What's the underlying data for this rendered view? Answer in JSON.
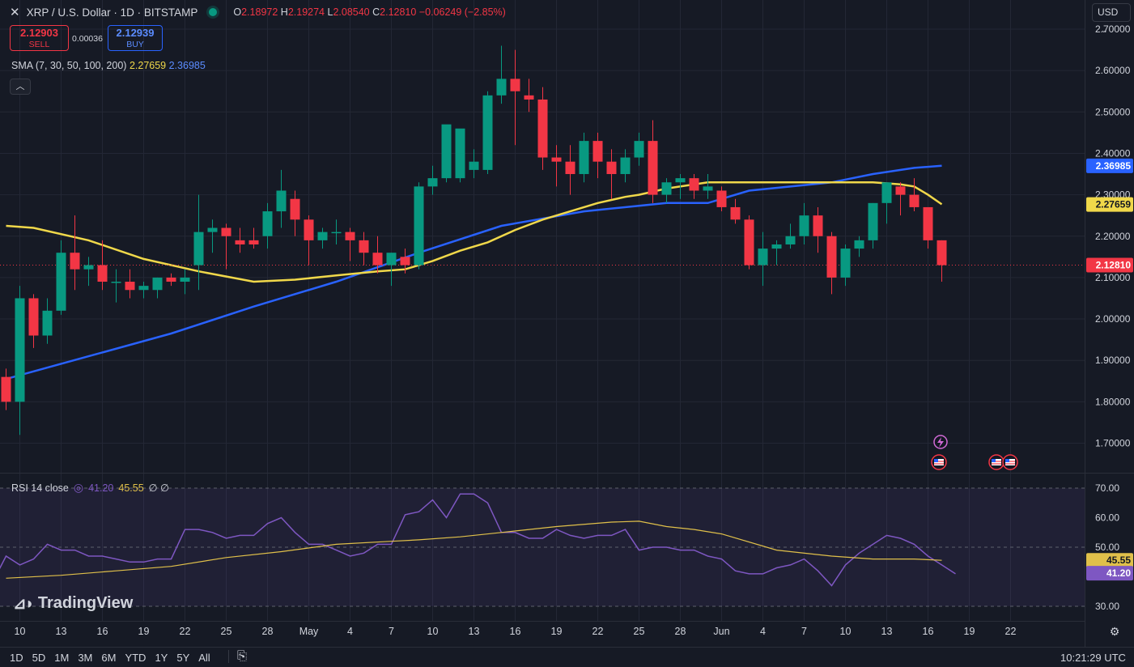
{
  "header": {
    "symbol": "XRP / U.S. Dollar · 1D · BITSTAMP",
    "ohlc": {
      "o_label": "O",
      "o": "2.18972",
      "h_label": "H",
      "h": "2.19274",
      "l_label": "L",
      "l": "2.08540",
      "c_label": "C",
      "c": "2.12810",
      "change": "−0.06249 (−2.85%)"
    }
  },
  "trade": {
    "sell_price": "2.12903",
    "sell_label": "SELL",
    "spread": "0.00036",
    "buy_price": "2.12939",
    "buy_label": "BUY"
  },
  "sma_legend": {
    "label": "SMA (7, 30, 50, 100, 200)",
    "v1": "2.27659",
    "v2": "2.36985"
  },
  "rsi_legend": {
    "label": "RSI 14 close",
    "v1": "41.20",
    "v2": "45.55",
    "extra": "∅ ∅"
  },
  "currency": "USD",
  "brand": "TradingView",
  "range_buttons": [
    "1D",
    "5D",
    "1M",
    "3M",
    "6M",
    "YTD",
    "1Y",
    "5Y",
    "All"
  ],
  "clock": "10:21:29 UTC",
  "colors": {
    "up": "#089981",
    "down": "#f23645",
    "sma_yellow": "#f0d84a",
    "sma_blue": "#2962ff",
    "rsi_line": "#7e57c2",
    "rsi_ma": "#e0c04a",
    "background": "#161a25",
    "grid": "#232735"
  },
  "chart_data": {
    "type": "candlestick",
    "price_axis": {
      "ticks": [
        "2.70000",
        "2.60000",
        "2.50000",
        "2.40000",
        "2.30000",
        "2.20000",
        "2.10000",
        "2.00000",
        "1.90000",
        "1.80000",
        "1.70000"
      ],
      "range": [
        1.655,
        2.71
      ]
    },
    "x_axis": {
      "ticks": [
        "10",
        "13",
        "16",
        "19",
        "22",
        "25",
        "28",
        "May",
        "4",
        "7",
        "10",
        "13",
        "16",
        "19",
        "22",
        "25",
        "28",
        "Jun",
        "4",
        "7",
        "10",
        "13",
        "16",
        "19",
        "22"
      ]
    },
    "candles": [
      {
        "o": 1.86,
        "h": 1.88,
        "l": 1.78,
        "c": 1.8
      },
      {
        "o": 1.8,
        "h": 2.08,
        "l": 1.72,
        "c": 2.05
      },
      {
        "o": 2.05,
        "h": 2.06,
        "l": 1.93,
        "c": 1.96
      },
      {
        "o": 1.96,
        "h": 2.05,
        "l": 1.94,
        "c": 2.02
      },
      {
        "o": 2.02,
        "h": 2.19,
        "l": 2.01,
        "c": 2.16
      },
      {
        "o": 2.16,
        "h": 2.25,
        "l": 2.07,
        "c": 2.12
      },
      {
        "o": 2.12,
        "h": 2.15,
        "l": 2.08,
        "c": 2.13
      },
      {
        "o": 2.13,
        "h": 2.19,
        "l": 2.07,
        "c": 2.09
      },
      {
        "o": 2.09,
        "h": 2.12,
        "l": 2.04,
        "c": 2.09
      },
      {
        "o": 2.09,
        "h": 2.12,
        "l": 2.05,
        "c": 2.07
      },
      {
        "o": 2.07,
        "h": 2.09,
        "l": 2.05,
        "c": 2.08
      },
      {
        "o": 2.07,
        "h": 2.1,
        "l": 2.05,
        "c": 2.1
      },
      {
        "o": 2.1,
        "h": 2.11,
        "l": 2.08,
        "c": 2.09
      },
      {
        "o": 2.09,
        "h": 2.12,
        "l": 2.06,
        "c": 2.1
      },
      {
        "o": 2.13,
        "h": 2.3,
        "l": 2.07,
        "c": 2.21
      },
      {
        "o": 2.21,
        "h": 2.24,
        "l": 2.16,
        "c": 2.22
      },
      {
        "o": 2.22,
        "h": 2.23,
        "l": 2.12,
        "c": 2.2
      },
      {
        "o": 2.19,
        "h": 2.22,
        "l": 2.16,
        "c": 2.18
      },
      {
        "o": 2.19,
        "h": 2.22,
        "l": 2.17,
        "c": 2.18
      },
      {
        "o": 2.2,
        "h": 2.28,
        "l": 2.17,
        "c": 2.26
      },
      {
        "o": 2.26,
        "h": 2.36,
        "l": 2.22,
        "c": 2.31
      },
      {
        "o": 2.29,
        "h": 2.31,
        "l": 2.2,
        "c": 2.24
      },
      {
        "o": 2.24,
        "h": 2.25,
        "l": 2.13,
        "c": 2.19
      },
      {
        "o": 2.19,
        "h": 2.22,
        "l": 2.17,
        "c": 2.21
      },
      {
        "o": 2.21,
        "h": 2.24,
        "l": 2.18,
        "c": 2.21
      },
      {
        "o": 2.21,
        "h": 2.22,
        "l": 2.14,
        "c": 2.19
      },
      {
        "o": 2.19,
        "h": 2.21,
        "l": 2.13,
        "c": 2.16
      },
      {
        "o": 2.16,
        "h": 2.2,
        "l": 2.11,
        "c": 2.13
      },
      {
        "o": 2.13,
        "h": 2.16,
        "l": 2.08,
        "c": 2.16
      },
      {
        "o": 2.15,
        "h": 2.17,
        "l": 2.11,
        "c": 2.13
      },
      {
        "o": 2.13,
        "h": 2.33,
        "l": 2.12,
        "c": 2.32
      },
      {
        "o": 2.32,
        "h": 2.37,
        "l": 2.3,
        "c": 2.34
      },
      {
        "o": 2.34,
        "h": 2.44,
        "l": 2.33,
        "c": 2.47
      },
      {
        "o": 2.34,
        "h": 2.4,
        "l": 2.33,
        "c": 2.46
      },
      {
        "o": 2.36,
        "h": 2.41,
        "l": 2.34,
        "c": 2.38
      },
      {
        "o": 2.36,
        "h": 2.55,
        "l": 2.35,
        "c": 2.54
      },
      {
        "o": 2.54,
        "h": 2.66,
        "l": 2.52,
        "c": 2.58
      },
      {
        "o": 2.58,
        "h": 2.65,
        "l": 2.42,
        "c": 2.55
      },
      {
        "o": 2.54,
        "h": 2.58,
        "l": 2.5,
        "c": 2.53
      },
      {
        "o": 2.53,
        "h": 2.56,
        "l": 2.36,
        "c": 2.39
      },
      {
        "o": 2.39,
        "h": 2.42,
        "l": 2.32,
        "c": 2.38
      },
      {
        "o": 2.38,
        "h": 2.42,
        "l": 2.3,
        "c": 2.35
      },
      {
        "o": 2.35,
        "h": 2.45,
        "l": 2.33,
        "c": 2.43
      },
      {
        "o": 2.43,
        "h": 2.45,
        "l": 2.34,
        "c": 2.38
      },
      {
        "o": 2.38,
        "h": 2.41,
        "l": 2.29,
        "c": 2.35
      },
      {
        "o": 2.35,
        "h": 2.41,
        "l": 2.33,
        "c": 2.39
      },
      {
        "o": 2.39,
        "h": 2.45,
        "l": 2.37,
        "c": 2.43
      },
      {
        "o": 2.43,
        "h": 2.48,
        "l": 2.28,
        "c": 2.3
      },
      {
        "o": 2.3,
        "h": 2.34,
        "l": 2.28,
        "c": 2.33
      },
      {
        "o": 2.33,
        "h": 2.35,
        "l": 2.29,
        "c": 2.34
      },
      {
        "o": 2.34,
        "h": 2.35,
        "l": 2.29,
        "c": 2.31
      },
      {
        "o": 2.31,
        "h": 2.35,
        "l": 2.29,
        "c": 2.32
      },
      {
        "o": 2.31,
        "h": 2.32,
        "l": 2.26,
        "c": 2.27
      },
      {
        "o": 2.27,
        "h": 2.29,
        "l": 2.23,
        "c": 2.24
      },
      {
        "o": 2.24,
        "h": 2.25,
        "l": 2.12,
        "c": 2.13
      },
      {
        "o": 2.13,
        "h": 2.21,
        "l": 2.08,
        "c": 2.17
      },
      {
        "o": 2.17,
        "h": 2.19,
        "l": 2.13,
        "c": 2.18
      },
      {
        "o": 2.18,
        "h": 2.23,
        "l": 2.17,
        "c": 2.2
      },
      {
        "o": 2.2,
        "h": 2.28,
        "l": 2.18,
        "c": 2.25
      },
      {
        "o": 2.25,
        "h": 2.27,
        "l": 2.16,
        "c": 2.2
      },
      {
        "o": 2.2,
        "h": 2.21,
        "l": 2.06,
        "c": 2.1
      },
      {
        "o": 2.1,
        "h": 2.18,
        "l": 2.08,
        "c": 2.17
      },
      {
        "o": 2.17,
        "h": 2.2,
        "l": 2.15,
        "c": 2.19
      },
      {
        "o": 2.19,
        "h": 2.28,
        "l": 2.17,
        "c": 2.28
      },
      {
        "o": 2.28,
        "h": 2.33,
        "l": 2.23,
        "c": 2.33
      },
      {
        "o": 2.32,
        "h": 2.33,
        "l": 2.25,
        "c": 2.3
      },
      {
        "o": 2.3,
        "h": 2.34,
        "l": 2.26,
        "c": 2.27
      },
      {
        "o": 2.27,
        "h": 2.27,
        "l": 2.17,
        "c": 2.19
      },
      {
        "o": 2.19,
        "h": 2.19,
        "l": 2.09,
        "c": 2.13
      }
    ],
    "sma_yellow": [
      [
        0,
        2.225
      ],
      [
        2,
        2.22
      ],
      [
        6,
        2.19
      ],
      [
        10,
        2.145
      ],
      [
        14,
        2.115
      ],
      [
        18,
        2.09
      ],
      [
        21,
        2.095
      ],
      [
        24,
        2.105
      ],
      [
        27,
        2.115
      ],
      [
        29,
        2.12
      ],
      [
        31,
        2.14
      ],
      [
        33,
        2.165
      ],
      [
        35,
        2.185
      ],
      [
        37,
        2.215
      ],
      [
        39,
        2.24
      ],
      [
        41,
        2.26
      ],
      [
        43,
        2.28
      ],
      [
        45,
        2.295
      ],
      [
        46,
        2.3
      ],
      [
        48,
        2.315
      ],
      [
        51,
        2.33
      ],
      [
        56,
        2.33
      ],
      [
        60,
        2.33
      ],
      [
        63,
        2.33
      ],
      [
        65,
        2.325
      ],
      [
        66,
        2.32
      ],
      [
        67,
        2.3
      ],
      [
        68,
        2.277
      ]
    ],
    "sma_blue": [
      [
        0,
        1.855
      ],
      [
        6,
        1.91
      ],
      [
        12,
        1.965
      ],
      [
        18,
        2.03
      ],
      [
        24,
        2.09
      ],
      [
        30,
        2.16
      ],
      [
        36,
        2.225
      ],
      [
        42,
        2.26
      ],
      [
        48,
        2.28
      ],
      [
        51,
        2.28
      ],
      [
        54,
        2.31
      ],
      [
        57,
        2.32
      ],
      [
        60,
        2.33
      ],
      [
        63,
        2.35
      ],
      [
        66,
        2.365
      ],
      [
        68,
        2.37
      ]
    ],
    "rsi_axis": {
      "ticks": [
        "70.00",
        "60.00",
        "50.00",
        "40.00",
        "30.00"
      ],
      "levels": [
        70,
        50,
        30
      ],
      "range": [
        27,
        73
      ]
    },
    "rsi": [
      38,
      47,
      44,
      46,
      51,
      49,
      49,
      47,
      47,
      46,
      45,
      45,
      46,
      46,
      56,
      56,
      55,
      53,
      54,
      54,
      58,
      60,
      55,
      51,
      51,
      49,
      47,
      48,
      51,
      51,
      61,
      62,
      66,
      60,
      68,
      68,
      65,
      55,
      55,
      53,
      53,
      56,
      54,
      53,
      54,
      54,
      56,
      49,
      50,
      50,
      49,
      49,
      47,
      46,
      42,
      41,
      41,
      43,
      44,
      46,
      42,
      37,
      44,
      48,
      51,
      54,
      53,
      51,
      47,
      44,
      41
    ],
    "rsi_ma": [
      [
        0,
        39.5
      ],
      [
        4,
        40.5
      ],
      [
        8,
        42
      ],
      [
        12,
        43.5
      ],
      [
        16,
        46.5
      ],
      [
        20,
        48.5
      ],
      [
        24,
        51
      ],
      [
        28,
        52
      ],
      [
        30,
        52.5
      ],
      [
        33,
        53.5
      ],
      [
        36,
        55
      ],
      [
        40,
        57
      ],
      [
        44,
        58.5
      ],
      [
        46,
        58.8
      ],
      [
        48,
        57
      ],
      [
        50,
        56
      ],
      [
        52,
        54.5
      ],
      [
        56,
        49
      ],
      [
        60,
        47
      ],
      [
        63,
        46
      ],
      [
        66,
        46
      ],
      [
        68,
        45.55
      ]
    ]
  }
}
